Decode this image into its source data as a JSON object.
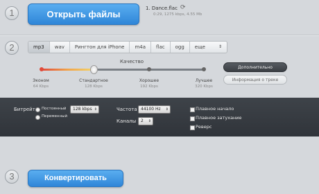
{
  "steps": {
    "one": "1",
    "two": "2",
    "three": "3"
  },
  "open_button": {
    "label": "Открыть файлы"
  },
  "file": {
    "name": "1. Dance.flac",
    "info": "0:29, 1275 kbps, 4.55 Mb",
    "icon": "loading-icon"
  },
  "formats": {
    "items": [
      "mp3",
      "wav",
      "Рингтон для iPhone",
      "m4a",
      "flac",
      "ogg"
    ],
    "more": "еще",
    "selected": "mp3"
  },
  "quality": {
    "title": "Качество",
    "level_index": 1,
    "ticks": [
      {
        "label": "Эконом",
        "sub": "64 Kbps"
      },
      {
        "label": "Стандартное",
        "sub": "128 Kbps"
      },
      {
        "label": "Хорошее",
        "sub": "192 Kbps"
      },
      {
        "label": "Лучшее",
        "sub": "320 Kbps"
      }
    ]
  },
  "side_buttons": {
    "advanced": "Дополнительно",
    "info": "Информация о треке"
  },
  "settings": {
    "bitrate_label": "Битрейт",
    "constant": "Постоянный",
    "variable": "Переменный",
    "bitrate_value": "128 kbps",
    "frequency_label": "Частота",
    "frequency_value": "44100 Hz",
    "channels_label": "Каналы",
    "channels_value": "2",
    "fade_in": "Плавное начало",
    "fade_out": "Плавное затухание",
    "reverse": "Реверс"
  },
  "convert_button": {
    "label": "Конвертировать"
  },
  "colors": {
    "accent": "#2f86d8",
    "dark_panel": "#363a40"
  }
}
